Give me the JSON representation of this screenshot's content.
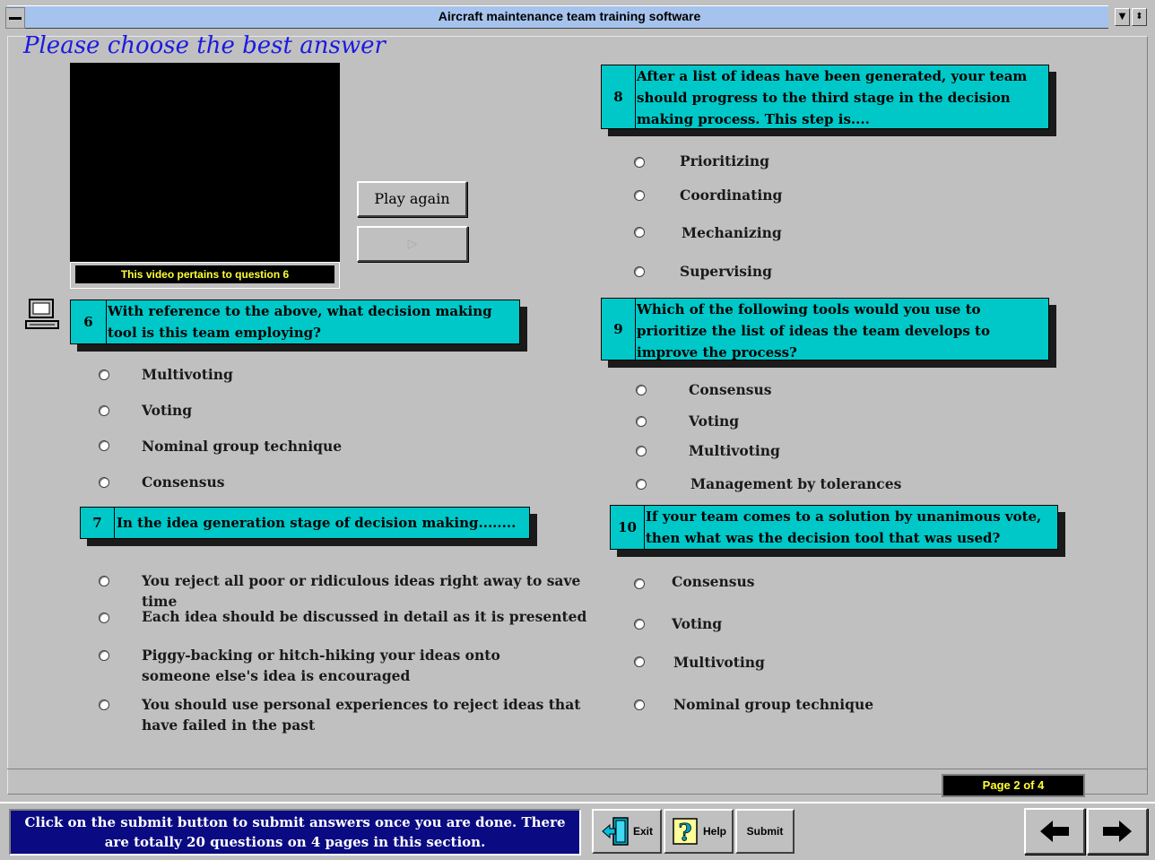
{
  "window": {
    "title": "Aircraft maintenance team training software",
    "system_menu_icon": "minus-icon",
    "minimize_icon": "arrow-down-icon",
    "restore_icon": "arrow-updown-icon"
  },
  "heading": "Please choose the best answer",
  "video": {
    "caption": "This video pertains to question 6",
    "play_again_label": "Play again",
    "play_icon": "play-icon"
  },
  "questions": [
    {
      "number": "6",
      "text": "With reference to the above, what decision making tool is this team employing?",
      "options": [
        "Multivoting",
        "Voting",
        "Nominal group technique",
        "Consensus"
      ]
    },
    {
      "number": "7",
      "text": "In the idea generation stage of decision making........",
      "options": [
        "You reject all poor or ridiculous ideas right away to save time",
        "Each idea should be discussed in detail as it is presented",
        "Piggy-backing or hitch-hiking your ideas onto someone else's idea is encouraged",
        "You should use personal experiences to reject ideas that have failed in the past"
      ]
    },
    {
      "number": "8",
      "text": "After a list of ideas have been generated, your team should progress to the third stage in the decision making process. This step is....",
      "options": [
        "Prioritizing",
        "Coordinating",
        "Mechanizing",
        "Supervising"
      ]
    },
    {
      "number": "9",
      "text": "Which of the following tools would you use to prioritize the list of ideas the team develops to improve the process?",
      "options": [
        "Consensus",
        "Voting",
        "Multivoting",
        "Management by tolerances"
      ]
    },
    {
      "number": "10",
      "text": "If your team comes to a solution by unanimous vote, then what was the decision tool that was used?",
      "options": [
        "Consensus",
        "Voting",
        "Multivoting",
        "Nominal group technique"
      ]
    }
  ],
  "footer": {
    "message": "Click on the submit button to submit answers once you are done. There are totally 20 questions on 4 pages in this section.",
    "page_indicator": "Page 2 of 4",
    "exit_label": "Exit",
    "help_label": "Help",
    "submit_label": "Submit",
    "prev_icon": "arrow-left-icon",
    "next_icon": "arrow-right-icon"
  },
  "colors": {
    "question_box": "#00c8c8",
    "heading": "#1a1ae0",
    "footer_message_bg": "#0a0a82",
    "title_bar": "#a5c3ec",
    "page_indicator_text": "#ffff33"
  }
}
